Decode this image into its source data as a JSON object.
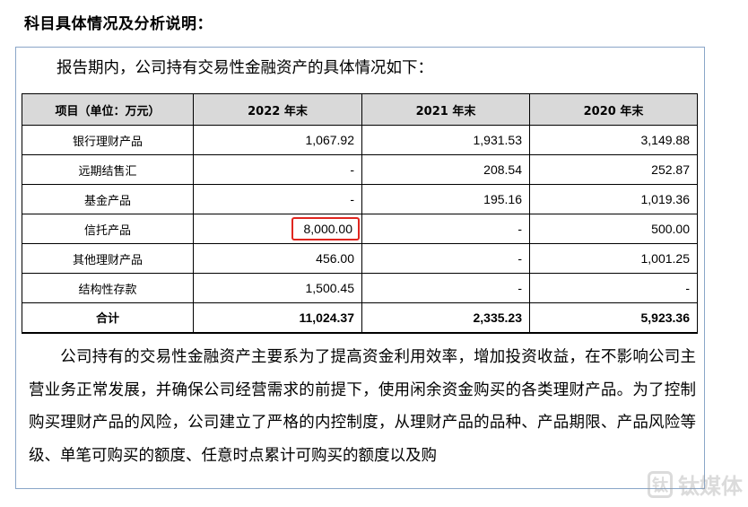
{
  "section_heading": "科目具体情况及分析说明：",
  "intro": "报告期内，公司持有交易性金融资产的具体情况如下：",
  "table": {
    "headers": [
      "项目（单位：万元）",
      "2022 年末",
      "2021 年末",
      "2020 年末"
    ],
    "rows": [
      {
        "label": "银行理财产品",
        "v2022": "1,067.92",
        "v2021": "1,931.53",
        "v2020": "3,149.88"
      },
      {
        "label": "远期结售汇",
        "v2022": "-",
        "v2021": "208.54",
        "v2020": "252.87"
      },
      {
        "label": "基金产品",
        "v2022": "-",
        "v2021": "195.16",
        "v2020": "1,019.36"
      },
      {
        "label": "信托产品",
        "v2022": "8,000.00",
        "v2021": "-",
        "v2020": "500.00"
      },
      {
        "label": "其他理财产品",
        "v2022": "456.00",
        "v2021": "-",
        "v2020": "1,001.25"
      },
      {
        "label": "结构性存款",
        "v2022": "1,500.45",
        "v2021": "-",
        "v2020": "-"
      }
    ],
    "total": {
      "label": "合计",
      "v2022": "11,024.37",
      "v2021": "2,335.23",
      "v2020": "5,923.36"
    },
    "highlight_color": "#e0261f"
  },
  "paragraph": "公司持有的交易性金融资产主要系为了提高资金利用效率，增加投资收益，在不影响公司主营业务正常发展，并确保公司经营需求的前提下，使用闲余资金购买的各类理财产品。为了控制购买理财产品的风险，公司建立了严格的内控制度，从理财产品的品种、产品期限、产品风险等级、单笔可购买的额度、任意时点累计可购买的额度以及购",
  "watermark": {
    "icon_text": "钛",
    "text": "钛媒体"
  }
}
